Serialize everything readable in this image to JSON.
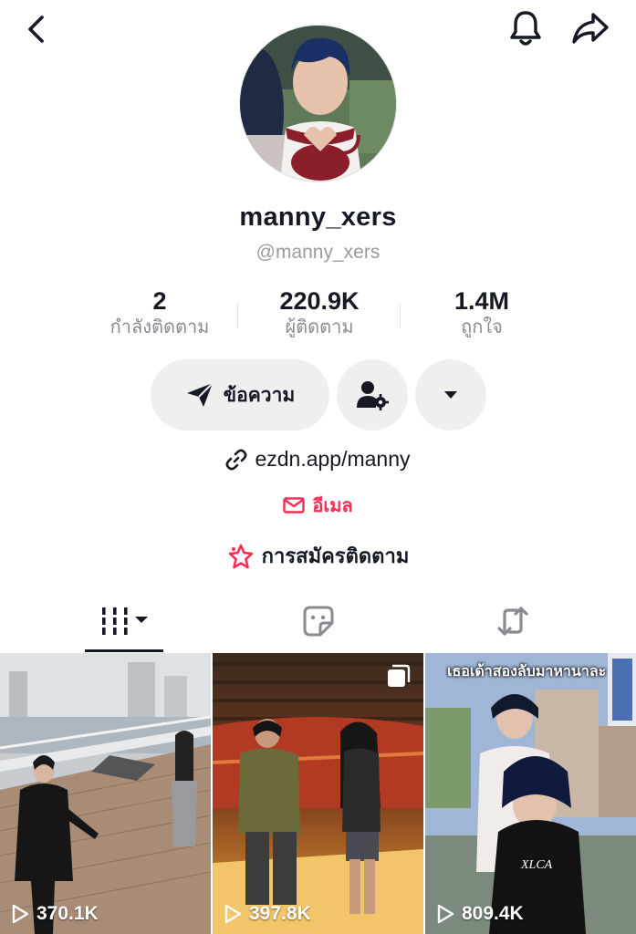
{
  "profile": {
    "display_name": "manny_xers",
    "handle": "@manny_xers",
    "link": "ezdn.app/manny",
    "email_label": "อีเมล",
    "subscribe_label": "การสมัครติดตาม"
  },
  "stats": [
    {
      "value": "2",
      "label": "กำลังติดตาม"
    },
    {
      "value": "220.9K",
      "label": "ผู้ติดตาม"
    },
    {
      "value": "1.4M",
      "label": "ถูกใจ"
    }
  ],
  "actions": {
    "message_label": "ข้อความ"
  },
  "icons": {
    "back": "chevron-left-icon",
    "bell": "bell-icon",
    "share": "share-arrow-icon",
    "message": "send-icon",
    "follow_settings": "person-gear-icon",
    "more": "caret-down-icon",
    "link": "link-icon",
    "email": "mail-icon",
    "subscribe": "star-icon",
    "videos_tab": "grid-lines-icon",
    "favorites_tab": "sticker-icon",
    "reposts_tab": "repost-icon"
  },
  "colors": {
    "accent": "#fe2c55",
    "text": "#161823",
    "muted": "#8a8b91",
    "button_bg": "#efefef"
  },
  "videos": [
    {
      "views": "370.1K",
      "caption": ""
    },
    {
      "views": "397.8K",
      "caption": ""
    },
    {
      "views": "809.4K",
      "caption": "เธอเด้าสองลับมาหานาละ"
    }
  ]
}
